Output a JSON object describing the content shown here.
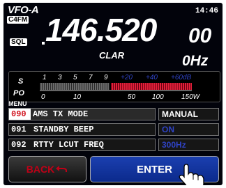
{
  "header": {
    "vfo": "VFO-A",
    "clock": "14:46",
    "mode_badge": "C4FM",
    "sql_badge": "SQL"
  },
  "frequency": {
    "main": "146.520",
    "small": "00",
    "clar_label": "CLAR",
    "clar_value": "0Hz"
  },
  "meter": {
    "s_label": "S",
    "po_label": "PO",
    "s_scale": [
      "1",
      "3",
      "5",
      "7",
      "9",
      "+20",
      "+40",
      "+60dB"
    ],
    "po_scale": [
      "0",
      "10",
      "50",
      "100",
      "150W"
    ]
  },
  "menu": {
    "label": "MENU",
    "items": [
      {
        "number": "090",
        "name": "AMS TX MODE",
        "value": "MANUAL",
        "selected": true
      },
      {
        "number": "091",
        "name": "STANDBY BEEP",
        "value": "ON",
        "selected": false
      },
      {
        "number": "092",
        "name": "RTTY LCUT FREQ",
        "value": "300Hz",
        "selected": false
      }
    ]
  },
  "buttons": {
    "back": "BACK",
    "enter": "ENTER"
  },
  "colors": {
    "accent_blue": "#1e4bd2",
    "back_red": "#c00016",
    "meter_red": "#e0203a",
    "dim_blue": "#2f43c6"
  }
}
